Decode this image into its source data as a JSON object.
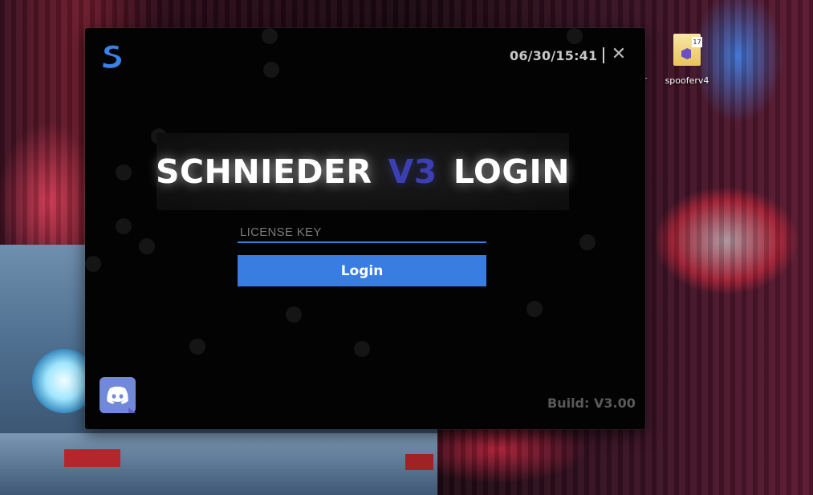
{
  "desktop": {
    "icon_label": "spooferv4",
    "icon_badge": "17",
    "partial_label": "ar"
  },
  "window": {
    "datetime": "06/30/15:41",
    "close_glyph": "✕",
    "title_left": "SCHNIEDER",
    "title_accent": "V3",
    "title_right": "LOGIN",
    "license_placeholder": "LICENSE KEY",
    "license_value": "",
    "login_label": "Login",
    "build": "Build: V3.00"
  },
  "icons": {
    "logo": "s-logo-icon",
    "discord": "discord-icon",
    "close": "close-icon"
  },
  "colors": {
    "accent": "#3a7de0",
    "title_accent": "#3b3fb2",
    "discord": "#7289da",
    "window_bg": "#030303"
  }
}
